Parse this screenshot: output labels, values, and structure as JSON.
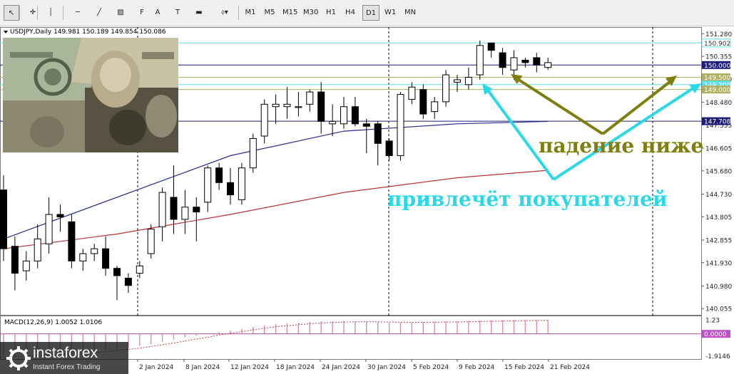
{
  "toolbar": {
    "tools": [
      {
        "name": "cursor-icon",
        "glyph": "↖"
      },
      {
        "name": "crosshair-icon",
        "glyph": "✛"
      },
      {
        "name": "vertical-line-icon",
        "glyph": "│"
      },
      {
        "name": "horizontal-line-icon",
        "glyph": "─"
      },
      {
        "name": "trendline-icon",
        "glyph": "╱"
      },
      {
        "name": "channel-icon",
        "glyph": "▨"
      },
      {
        "name": "fibonacci-icon",
        "glyph": "F"
      },
      {
        "name": "text-icon",
        "glyph": "A"
      },
      {
        "name": "text-label-icon",
        "glyph": "T"
      },
      {
        "name": "rectangle-icon",
        "glyph": "▬"
      },
      {
        "name": "shapes-menu-icon",
        "glyph": "⬨▾"
      }
    ],
    "timeframes": [
      "M1",
      "M5",
      "M15",
      "M30",
      "H1",
      "H4",
      "D1",
      "W1",
      "MN"
    ],
    "active_timeframe": "D1"
  },
  "chart_header": "USDJPY,Daily  149.981 150.189 149.854 150.086",
  "macd_header": "MACD(12,26,9) 1.0052 1.0106",
  "annotations": {
    "falling_below": "падение ниже",
    "attract_buyers": "привлечёт покупателей"
  },
  "watermark": {
    "brand": "instaforex",
    "tagline": "Instant Forex Trading"
  },
  "colors": {
    "annotation_olive": "#7f7f10",
    "annotation_cyan": "#29d9e8",
    "ma_fast": "#2a2a90",
    "ma_slow": "#c03030",
    "level_cyan": "#5fe0ea",
    "level_olive": "#b0b060",
    "level_navy": "#1c1c7a",
    "macd_hist": "#e08ab8",
    "macd_signal": "#c04040"
  },
  "chart_data": {
    "type": "candlestick",
    "symbol": "USDJPY",
    "timeframe": "Daily",
    "ylim": [
      139.8,
      151.55
    ],
    "y_ticks": [
      "151.280",
      "150.355",
      "149.430",
      "148.480",
      "147.555",
      "146.605",
      "145.680",
      "144.730",
      "143.805",
      "142.855",
      "141.930",
      "140.980",
      "140.055"
    ],
    "x_ticks": [
      "2 Jan 2024",
      "8 Jan 2024",
      "12 Jan 2024",
      "18 Jan 2024",
      "24 Jan 2024",
      "30 Jan 2024",
      "5 Feb 2024",
      "9 Feb 2024",
      "15 Feb 2024",
      "21 Feb 2024"
    ],
    "levels": [
      {
        "value": 150.902,
        "label": "150.902",
        "color": "#5fe0ea"
      },
      {
        "value": 150.0,
        "label": "150.000",
        "color": "#1c1c7a",
        "filled": true
      },
      {
        "value": 149.5,
        "label": "149.500",
        "color": "#b0b060",
        "filled": true
      },
      {
        "value": 149.2,
        "label": "149.200",
        "color": "#5fe0ea",
        "filled": true
      },
      {
        "value": 149.0,
        "label": "149.000",
        "color": "#b0b060",
        "filled": true
      },
      {
        "value": 147.708,
        "label": "147.708",
        "color": "#1c1c7a",
        "filled": true
      }
    ],
    "candles": [
      {
        "o": 144.9,
        "h": 145.5,
        "l": 142.0,
        "c": 142.5
      },
      {
        "o": 142.6,
        "h": 143.0,
        "l": 140.8,
        "c": 141.5
      },
      {
        "o": 141.6,
        "h": 142.4,
        "l": 141.2,
        "c": 142.0
      },
      {
        "o": 142.0,
        "h": 143.5,
        "l": 141.7,
        "c": 142.9
      },
      {
        "o": 142.7,
        "h": 144.6,
        "l": 142.3,
        "c": 143.9
      },
      {
        "o": 143.9,
        "h": 144.3,
        "l": 143.2,
        "c": 143.8
      },
      {
        "o": 143.6,
        "h": 143.9,
        "l": 141.7,
        "c": 142.0
      },
      {
        "o": 142.0,
        "h": 142.5,
        "l": 141.6,
        "c": 142.3
      },
      {
        "o": 142.3,
        "h": 142.7,
        "l": 142.0,
        "c": 142.5
      },
      {
        "o": 142.5,
        "h": 143.0,
        "l": 141.4,
        "c": 141.7
      },
      {
        "o": 141.7,
        "h": 141.8,
        "l": 140.4,
        "c": 141.4
      },
      {
        "o": 141.3,
        "h": 141.5,
        "l": 140.7,
        "c": 141.0
      },
      {
        "o": 141.5,
        "h": 142.0,
        "l": 141.3,
        "c": 141.8
      },
      {
        "o": 142.3,
        "h": 143.5,
        "l": 142.1,
        "c": 143.3
      },
      {
        "o": 143.4,
        "h": 145.0,
        "l": 142.8,
        "c": 144.8
      },
      {
        "o": 144.6,
        "h": 145.9,
        "l": 143.1,
        "c": 143.7
      },
      {
        "o": 143.7,
        "h": 144.9,
        "l": 143.1,
        "c": 144.2
      },
      {
        "o": 144.2,
        "h": 144.6,
        "l": 142.8,
        "c": 144.0
      },
      {
        "o": 144.4,
        "h": 145.9,
        "l": 144.0,
        "c": 145.8
      },
      {
        "o": 145.8,
        "h": 146.0,
        "l": 144.9,
        "c": 145.2
      },
      {
        "o": 145.2,
        "h": 145.8,
        "l": 144.3,
        "c": 144.7
      },
      {
        "o": 144.5,
        "h": 146.0,
        "l": 144.3,
        "c": 145.8
      },
      {
        "o": 145.8,
        "h": 147.2,
        "l": 145.6,
        "c": 147.0
      },
      {
        "o": 147.1,
        "h": 148.6,
        "l": 146.8,
        "c": 148.4
      },
      {
        "o": 148.3,
        "h": 148.8,
        "l": 147.6,
        "c": 148.4
      },
      {
        "o": 148.3,
        "h": 149.1,
        "l": 147.8,
        "c": 148.4
      },
      {
        "o": 148.3,
        "h": 148.9,
        "l": 147.9,
        "c": 148.3
      },
      {
        "o": 148.4,
        "h": 149.0,
        "l": 148.1,
        "c": 148.9
      },
      {
        "o": 148.9,
        "h": 149.3,
        "l": 147.2,
        "c": 147.7
      },
      {
        "o": 147.6,
        "h": 148.4,
        "l": 147.1,
        "c": 147.7
      },
      {
        "o": 147.6,
        "h": 148.7,
        "l": 147.4,
        "c": 148.3
      },
      {
        "o": 148.3,
        "h": 148.7,
        "l": 147.5,
        "c": 147.6
      },
      {
        "o": 147.6,
        "h": 147.8,
        "l": 146.4,
        "c": 147.5
      },
      {
        "o": 147.6,
        "h": 147.7,
        "l": 145.9,
        "c": 146.8
      },
      {
        "o": 146.9,
        "h": 147.0,
        "l": 146.1,
        "c": 146.3
      },
      {
        "o": 146.3,
        "h": 148.9,
        "l": 146.1,
        "c": 148.8
      },
      {
        "o": 148.6,
        "h": 149.3,
        "l": 148.4,
        "c": 149.1
      },
      {
        "o": 149.0,
        "h": 149.2,
        "l": 147.8,
        "c": 148.0
      },
      {
        "o": 148.1,
        "h": 148.7,
        "l": 147.8,
        "c": 148.5
      },
      {
        "o": 148.5,
        "h": 149.8,
        "l": 148.3,
        "c": 149.6
      },
      {
        "o": 149.3,
        "h": 149.6,
        "l": 148.9,
        "c": 149.4
      },
      {
        "o": 149.2,
        "h": 149.9,
        "l": 149.0,
        "c": 149.5
      },
      {
        "o": 149.6,
        "h": 151.0,
        "l": 149.4,
        "c": 150.8
      },
      {
        "o": 150.9,
        "h": 150.9,
        "l": 150.3,
        "c": 150.6
      },
      {
        "o": 150.5,
        "h": 150.7,
        "l": 149.6,
        "c": 149.9
      },
      {
        "o": 149.8,
        "h": 150.6,
        "l": 149.4,
        "c": 150.3
      },
      {
        "o": 150.2,
        "h": 150.3,
        "l": 149.9,
        "c": 150.1
      },
      {
        "o": 150.3,
        "h": 150.5,
        "l": 149.7,
        "c": 150.0
      },
      {
        "o": 149.9,
        "h": 150.3,
        "l": 149.8,
        "c": 150.1
      }
    ],
    "ma_fast": [
      {
        "i": 0,
        "v": 142.9
      },
      {
        "i": 20,
        "v": 146.3
      },
      {
        "i": 30,
        "v": 147.3
      },
      {
        "i": 40,
        "v": 147.6
      },
      {
        "i": 48,
        "v": 147.7
      }
    ],
    "ma_slow": [
      {
        "i": 0,
        "v": 142.5
      },
      {
        "i": 10,
        "v": 143.1
      },
      {
        "i": 20,
        "v": 143.9
      },
      {
        "i": 30,
        "v": 144.8
      },
      {
        "i": 40,
        "v": 145.4
      },
      {
        "i": 48,
        "v": 145.7
      }
    ],
    "macd": {
      "ylim": [
        -2.2,
        1.6
      ],
      "y_ticks": [
        "1.23",
        "0.0000",
        "-1.9146"
      ],
      "histogram": [
        -2.0,
        -1.95,
        -1.9,
        -1.85,
        -1.8,
        -1.75,
        -1.7,
        -1.6,
        -1.5,
        -1.4,
        -1.3,
        -1.2,
        -1.05,
        -0.9,
        -0.7,
        -0.5,
        -0.3,
        -0.15,
        0.0,
        0.15,
        0.3,
        0.45,
        0.6,
        0.75,
        0.85,
        0.95,
        1.0,
        1.05,
        1.1,
        1.12,
        1.14,
        1.1,
        1.08,
        1.05,
        1.0,
        1.0,
        1.02,
        1.05,
        1.08,
        1.1,
        1.12,
        1.15,
        1.18,
        1.2,
        1.21,
        1.22,
        1.2,
        1.2,
        1.2
      ],
      "signal": [
        -2.05,
        -2.0,
        -1.95,
        -1.9,
        -1.85,
        -1.8,
        -1.75,
        -1.7,
        -1.65,
        -1.55,
        -1.45,
        -1.35,
        -1.25,
        -1.1,
        -0.95,
        -0.8,
        -0.62,
        -0.45,
        -0.3,
        -0.1,
        0.05,
        0.2,
        0.35,
        0.5,
        0.62,
        0.72,
        0.8,
        0.88,
        0.95,
        1.0,
        1.03,
        1.05,
        1.05,
        1.05,
        1.03,
        1.02,
        1.01,
        1.01,
        1.02,
        1.03,
        1.04,
        1.06,
        1.08,
        1.1,
        1.12,
        1.14,
        1.16,
        1.17,
        1.18
      ]
    }
  }
}
